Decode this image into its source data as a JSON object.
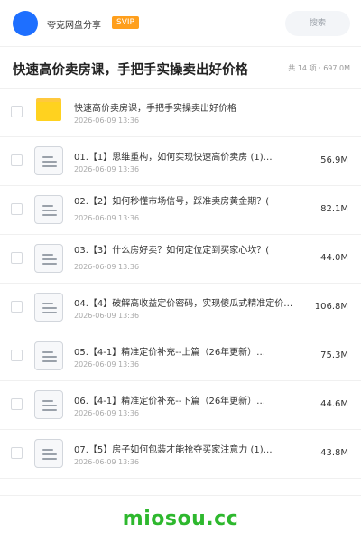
{
  "header": {
    "user_name": "夸克网盘分享",
    "badge": "SVIP",
    "search_placeholder": "搜索"
  },
  "title_row": {
    "title": "快速高价卖房课，手把手实操卖出好价格",
    "summary": "共 14 项 · 697.0M"
  },
  "items": [
    {
      "type": "folder",
      "name": "快速高价卖房课，手把手实操卖出好价格",
      "date": "2026-06-09 13:36",
      "size": ""
    },
    {
      "type": "file",
      "name": "01.【1】思维重构，如何实现快速高价卖房 (1)…",
      "date": "2026-06-09 13:36",
      "size": "56.9M"
    },
    {
      "type": "file",
      "name": "02.【2】如何秒懂市场信号，踩准卖房黄金期？(",
      "date": "2026-06-09 13:36",
      "size": "82.1M"
    },
    {
      "type": "file",
      "name": "03.【3】什么房好卖？如何定位定到买家心坎？(",
      "date": "2026-06-09 13:36",
      "size": "44.0M"
    },
    {
      "type": "file",
      "name": "04.【4】破解高收益定价密码，实现傻瓜式精准定价…",
      "date": "2026-06-09 13:36",
      "size": "106.8M"
    },
    {
      "type": "file",
      "name": "05.【4-1】精准定价补充--上篇（26年更新）…",
      "date": "2026-06-09 13:36",
      "size": "75.3M"
    },
    {
      "type": "file",
      "name": "06.【4-1】精准定价补充--下篇（26年更新）…",
      "date": "2026-06-09 13:36",
      "size": "44.6M"
    },
    {
      "type": "file",
      "name": "07.【5】房子如何包装才能抢夺买家注意力 (1)…",
      "date": "2026-06-09 13:36",
      "size": "43.8M"
    }
  ],
  "watermark": "miosou.cc",
  "colors": {
    "accent": "#1e6fff",
    "svip": "#ff9f1c",
    "folder": "#ffd21f",
    "watermark": "#2eb82e"
  }
}
